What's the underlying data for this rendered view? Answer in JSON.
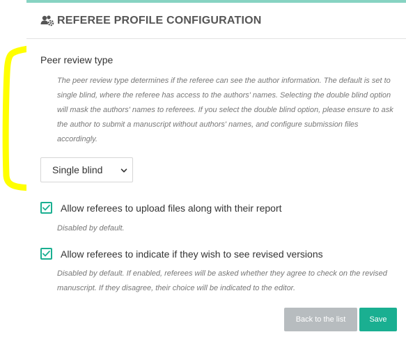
{
  "header": {
    "title": "REFEREE PROFILE CONFIGURATION",
    "icon": "users-gear-icon"
  },
  "peer_review": {
    "label": "Peer review type",
    "help": "The peer review type determines if the referee can see the author information. The default is set to single blind, where the referee has access to the authors' names. Selecting the double blind option will mask the authors' names to referees. If you select the double blind option, please ensure to ask the author to submit a manuscript without authors' names, and configure submission files accordingly.",
    "selected": "Single blind"
  },
  "options": [
    {
      "label": "Allow referees to upload files along with their report",
      "checked": true,
      "help": "Disabled by default."
    },
    {
      "label": "Allow referees to indicate if they wish to see revised versions",
      "checked": true,
      "help": "Disabled by default. If enabled, referees will be asked whether they agree to check on the revised manuscript. If they disagree, their choice will be indicated to the editor."
    }
  ],
  "buttons": {
    "back": "Back to the list",
    "save": "Save"
  },
  "colors": {
    "accent": "#1aaf91",
    "top_border": "#87d3c2",
    "back_button": "#b7bcbf",
    "annotation": "#ffff00"
  }
}
